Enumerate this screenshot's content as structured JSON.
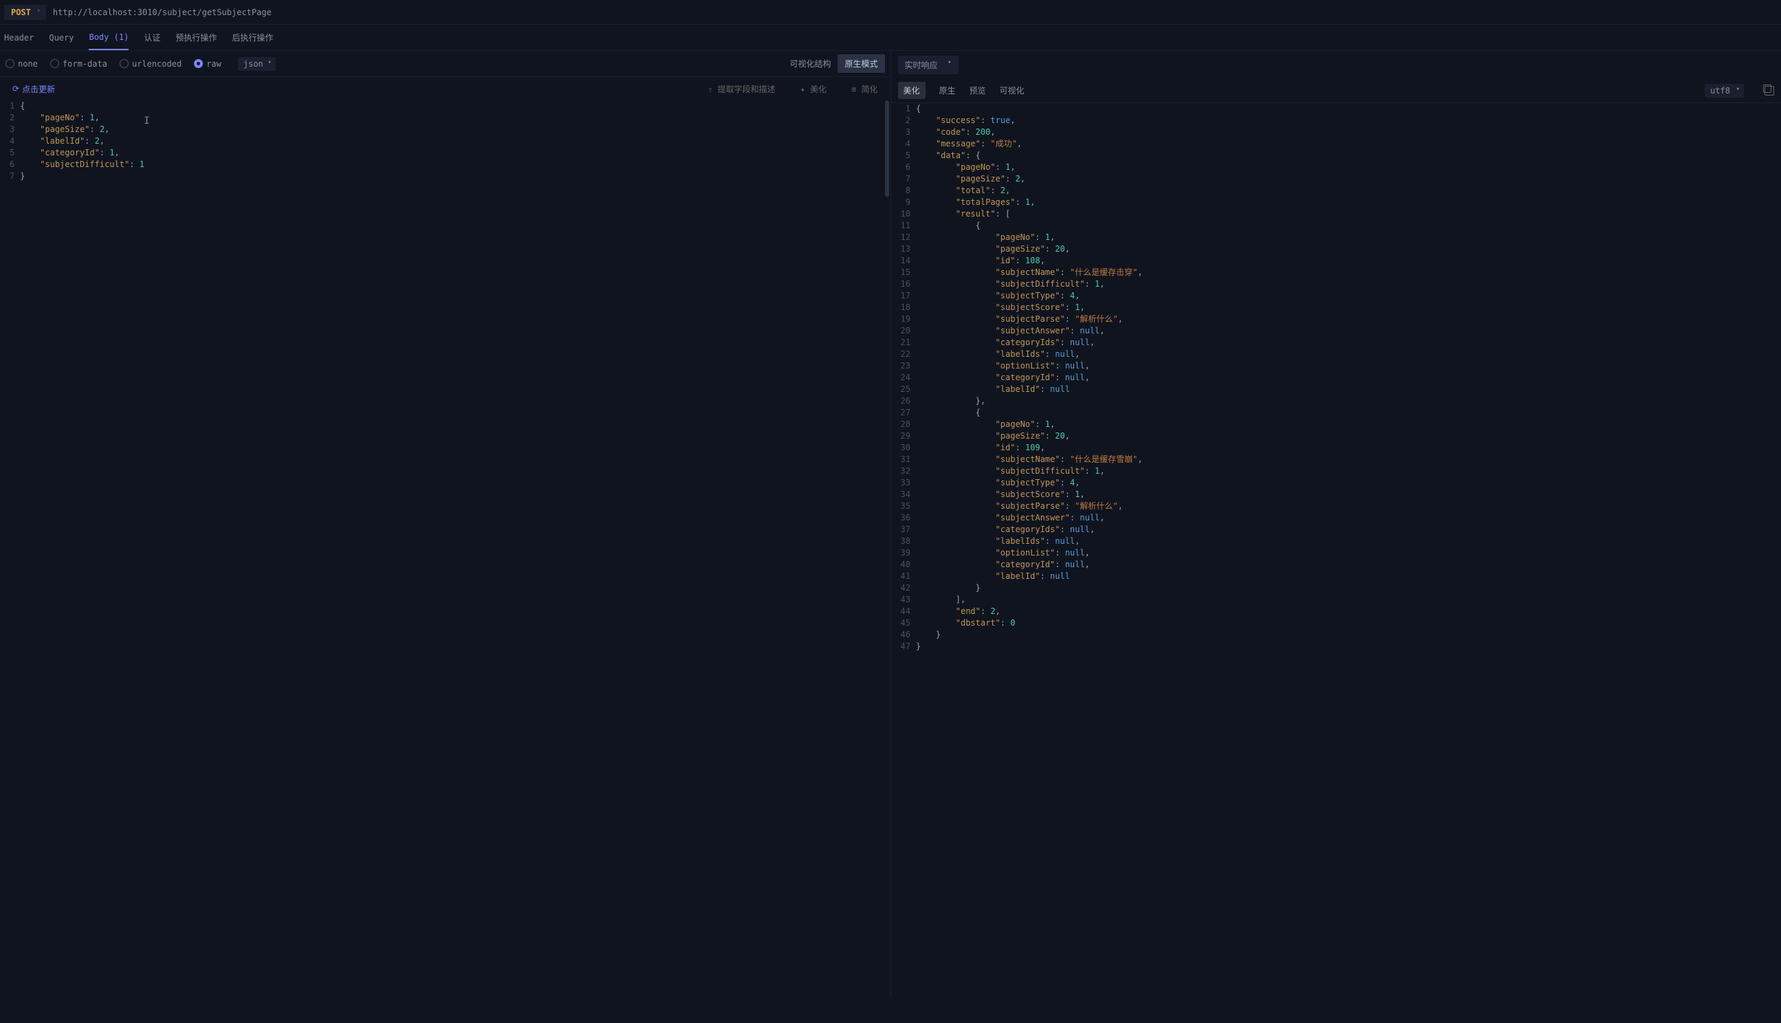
{
  "topbar": {
    "method": "POST",
    "url": "http://localhost:3010/subject/getSubjectPage"
  },
  "tabs": {
    "header": "Header",
    "query": "Query",
    "body": "Body",
    "body_count": "(1)",
    "auth": "认证",
    "pre": "预执行操作",
    "post": "后执行操作"
  },
  "bodytype": {
    "none": "none",
    "formdata": "form-data",
    "urlencoded": "urlencoded",
    "raw": "raw",
    "json": "json"
  },
  "viewmode": {
    "visual": "可视化结构",
    "raw": "原生模式"
  },
  "left_actions": {
    "refresh": "点击更新",
    "extract": "提取字段和描述",
    "beautify": "美化",
    "simplify": "简化"
  },
  "response": {
    "mode": "实时响应",
    "tabs": {
      "beautify": "美化",
      "raw": "原生",
      "preview": "预览",
      "visual": "可视化"
    },
    "encoding": "utf8"
  },
  "request_body": {
    "pageNo": 1,
    "pageSize": 2,
    "labelId": 2,
    "categoryId": 1,
    "subjectDifficult": 1
  },
  "response_body": {
    "success": true,
    "code": 200,
    "message": "成功",
    "data": {
      "pageNo": 1,
      "pageSize": 2,
      "total": 2,
      "totalPages": 1,
      "result": [
        {
          "pageNo": 1,
          "pageSize": 20,
          "id": 108,
          "subjectName": "什么是缓存击穿",
          "subjectDifficult": 1,
          "subjectType": 4,
          "subjectScore": 1,
          "subjectParse": "解析什么",
          "subjectAnswer": null,
          "categoryIds": null,
          "labelIds": null,
          "optionList": null,
          "categoryId": null,
          "labelId": null
        },
        {
          "pageNo": 1,
          "pageSize": 20,
          "id": 109,
          "subjectName": "什么是缓存雪崩",
          "subjectDifficult": 1,
          "subjectType": 4,
          "subjectScore": 1,
          "subjectParse": "解析什么",
          "subjectAnswer": null,
          "categoryIds": null,
          "labelIds": null,
          "optionList": null,
          "categoryId": null,
          "labelId": null
        }
      ],
      "end": 2,
      "dbstart": 0
    }
  }
}
